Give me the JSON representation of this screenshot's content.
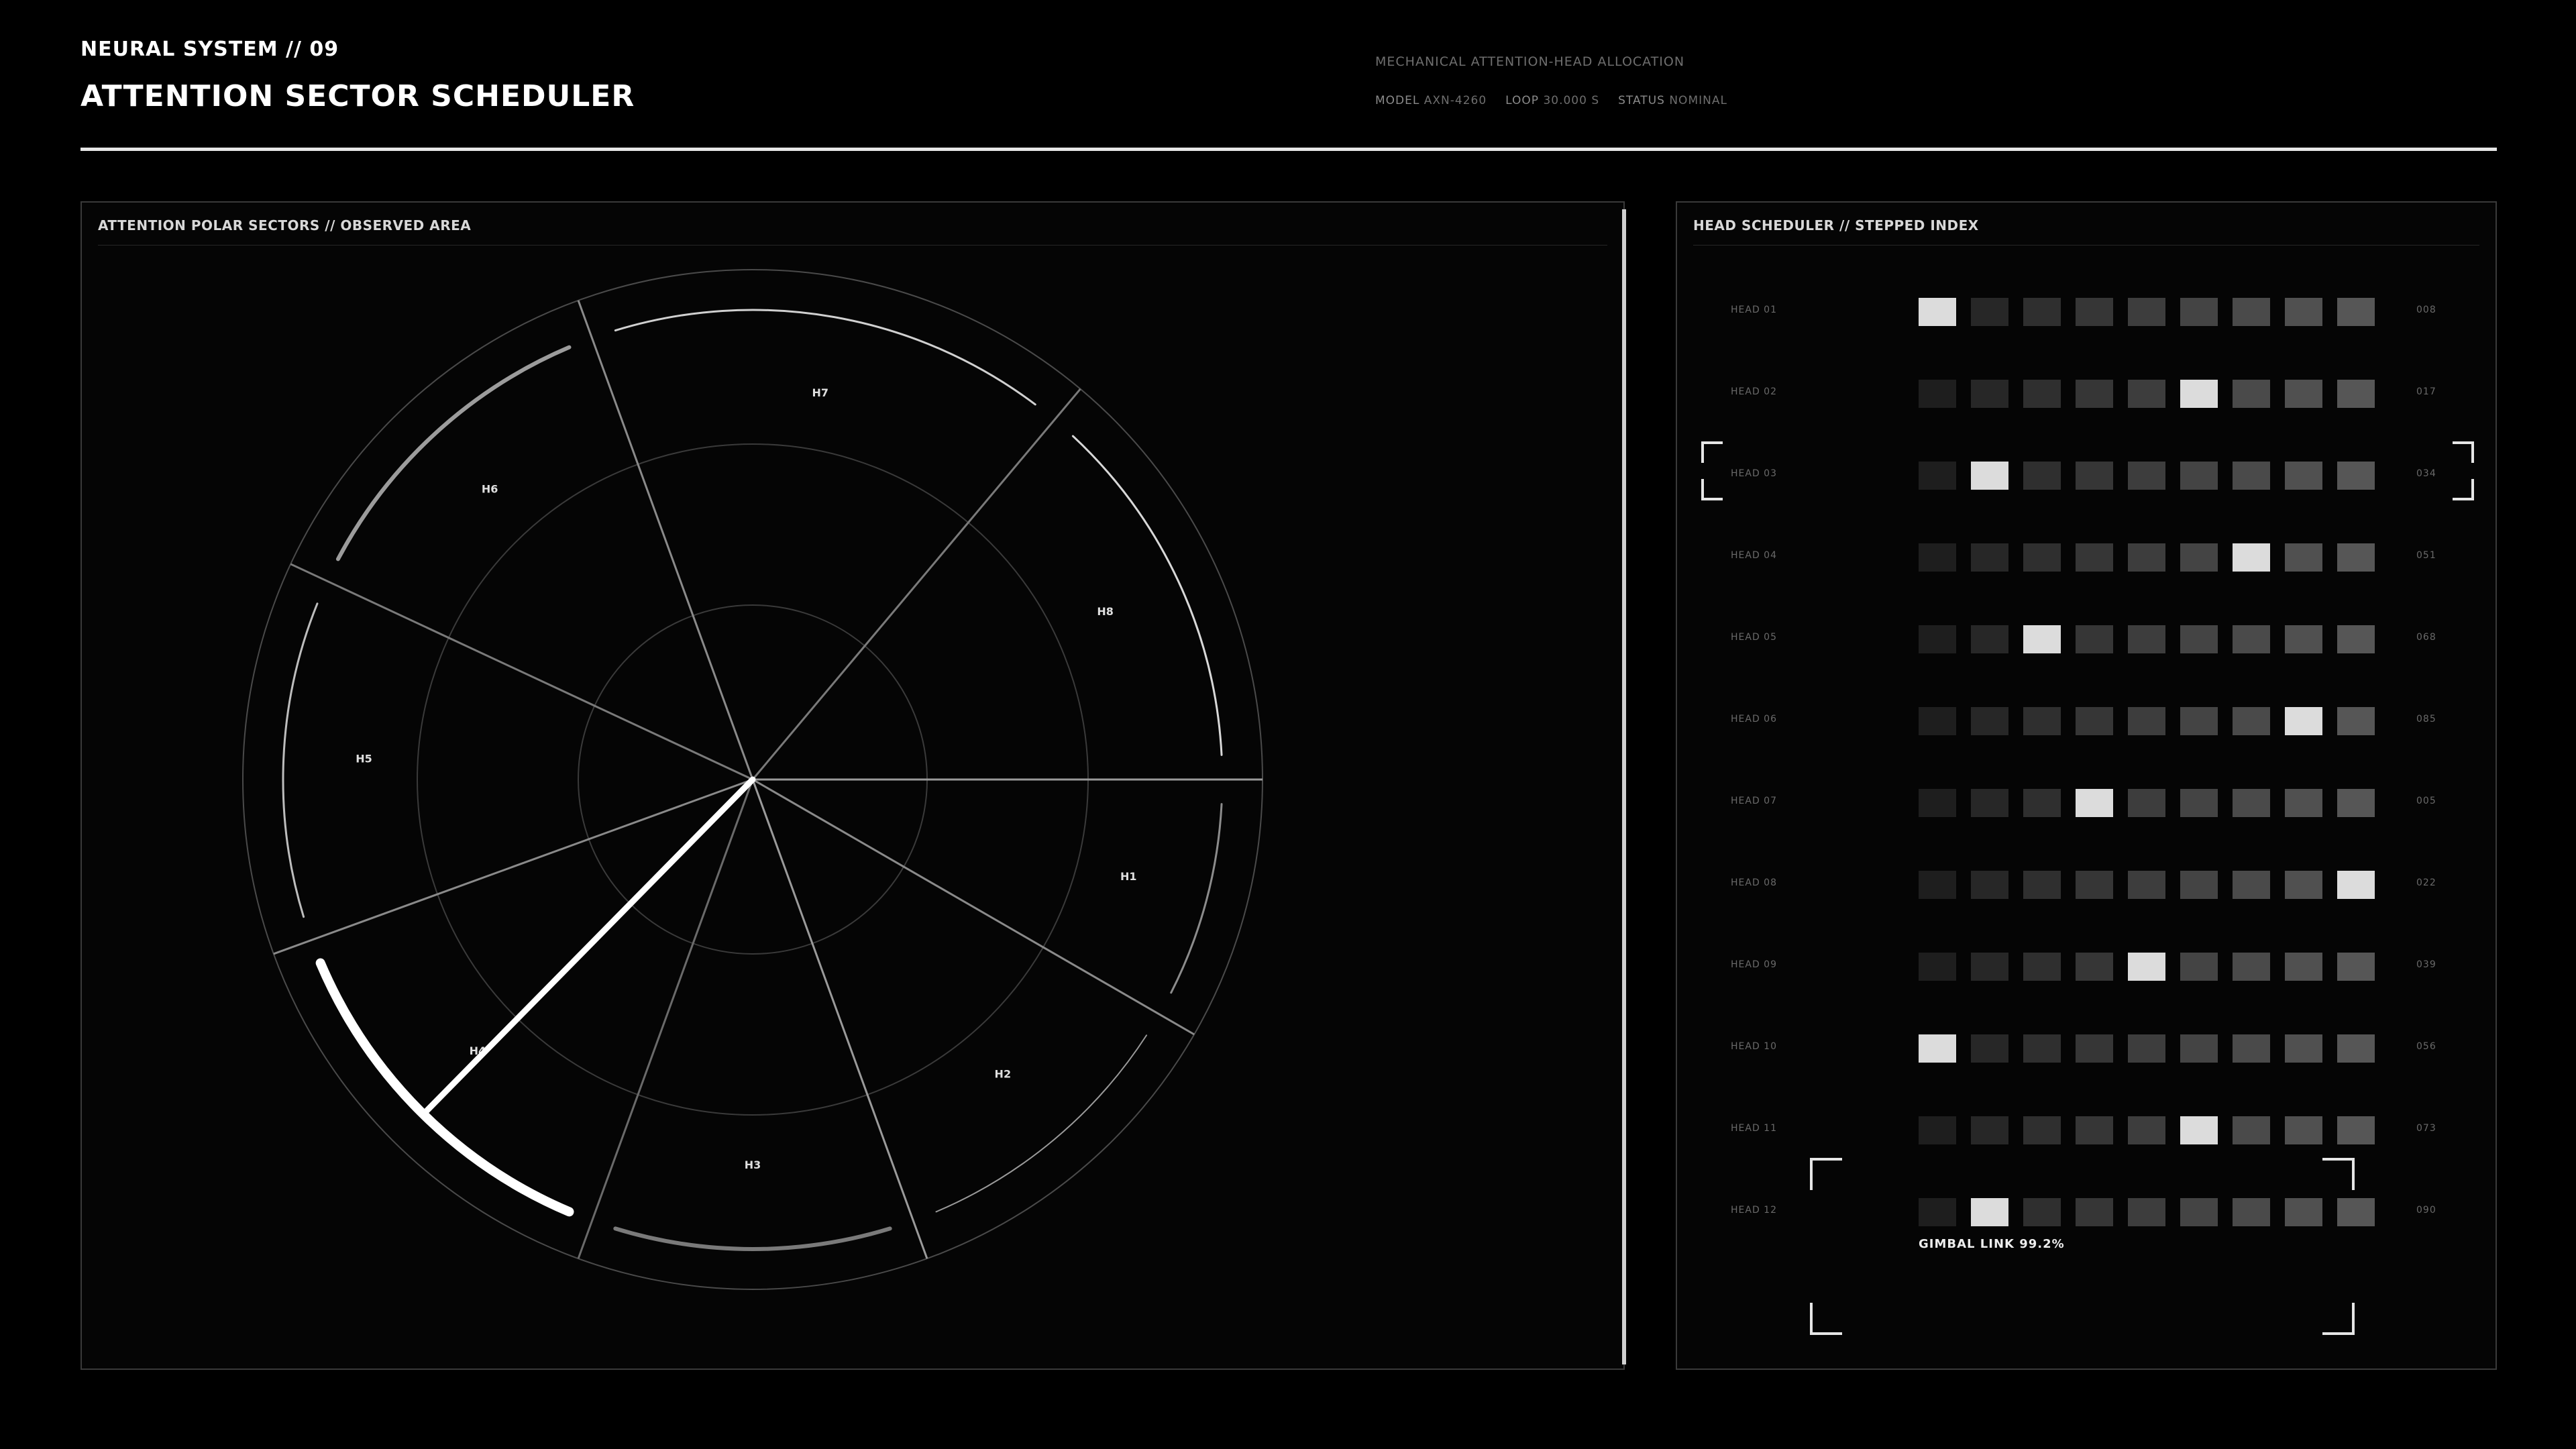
{
  "header": {
    "system": "NEURAL SYSTEM // 09",
    "title": "ATTENTION SECTOR SCHEDULER",
    "subtitle": "MECHANICAL ATTENTION-HEAD ALLOCATION",
    "meta": {
      "model_label": "MODEL",
      "model_value": "AXN-4260",
      "loop_label": "LOOP",
      "loop_value": "30.000 S",
      "status_label": "STATUS",
      "status_value": "NOMINAL"
    }
  },
  "polar_panel": {
    "title": "ATTENTION POLAR SECTORS // OBSERVED AREA",
    "sectors": [
      {
        "label": "H1"
      },
      {
        "label": "H2"
      },
      {
        "label": "H3"
      },
      {
        "label": "H4"
      },
      {
        "label": "H5"
      },
      {
        "label": "H6"
      },
      {
        "label": "H7"
      },
      {
        "label": "H8"
      }
    ],
    "active_sector": "H4"
  },
  "scheduler_panel": {
    "title": "HEAD SCHEDULER // STEPPED INDEX",
    "heads": [
      {
        "label": "HEAD 01",
        "active_step": 1,
        "code": "008"
      },
      {
        "label": "HEAD 02",
        "active_step": 6,
        "code": "017"
      },
      {
        "label": "HEAD 03",
        "active_step": 2,
        "code": "034"
      },
      {
        "label": "HEAD 04",
        "active_step": 7,
        "code": "051"
      },
      {
        "label": "HEAD 05",
        "active_step": 3,
        "code": "068"
      },
      {
        "label": "HEAD 06",
        "active_step": 8,
        "code": "085"
      },
      {
        "label": "HEAD 07",
        "active_step": 4,
        "code": "005"
      },
      {
        "label": "HEAD 08",
        "active_step": 9,
        "code": "022"
      },
      {
        "label": "HEAD 09",
        "active_step": 5,
        "code": "039"
      },
      {
        "label": "HEAD 10",
        "active_step": 1,
        "code": "056"
      },
      {
        "label": "HEAD 11",
        "active_step": 6,
        "code": "073"
      },
      {
        "label": "HEAD 12",
        "active_step": 2,
        "code": "090"
      }
    ],
    "selected_head": "HEAD 03",
    "gimbal_link": "GIMBAL LINK 99.2%"
  },
  "colors": {
    "active_cell": "#dcdcdc",
    "cell_ramp": [
      "#1e1e1e",
      "#272727",
      "#2f2f2f",
      "#363636",
      "#3d3d3d",
      "#444444",
      "#4a4a4a",
      "#505050",
      "#565656"
    ]
  }
}
